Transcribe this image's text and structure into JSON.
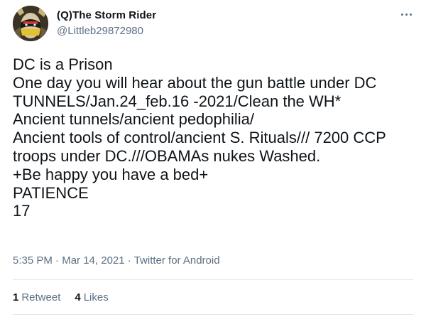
{
  "author": {
    "display_name": "(Q)The Storm Rider",
    "handle": "@Littleb29872980",
    "avatar_icon": "painted-face-avatar"
  },
  "more_icon": "more-dots-icon",
  "tweet": {
    "lines": [
      "DC is a Prison",
      "One day you will hear about the gun battle under DC",
      "TUNNELS/Jan.24_feb.16 -2021/Clean the WH*",
      "Ancient tunnels/ancient pedophilia/",
      "Ancient tools of control/ancient S. Rituals/// 7200 CCP",
      "troops under DC.///OBAMAs nukes Washed.",
      "+Be happy you have a bed+",
      "PATIENCE",
      "17"
    ]
  },
  "meta": {
    "time": "5:35 PM",
    "separator": "·",
    "date": "Mar 14, 2021",
    "source": "Twitter for Android"
  },
  "stats": {
    "retweets_count": "1",
    "retweets_label": "Retweet",
    "likes_count": "4",
    "likes_label": "Likes"
  },
  "colors": {
    "text": "#0f1419",
    "secondary": "#5b7083",
    "divider": "#e1e8ed"
  }
}
